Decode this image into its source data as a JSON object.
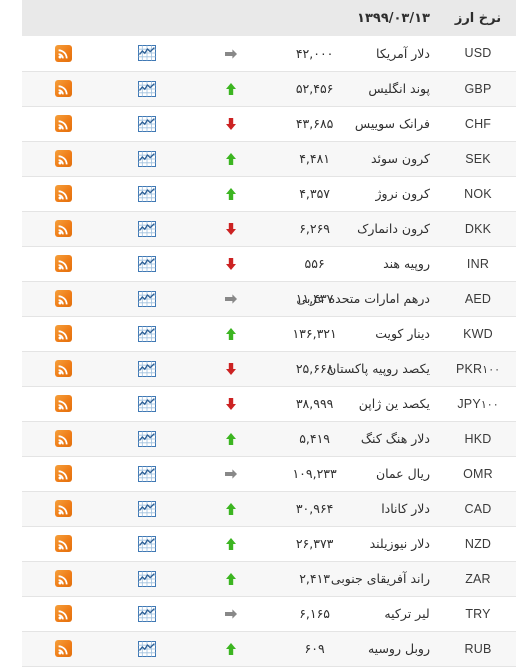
{
  "header": {
    "title": "نرخ ارز",
    "date": "۱۳۹۹/۰۳/۱۳"
  },
  "icons": {
    "rss": "rss-icon",
    "chart": "chart-icon",
    "trend_up": "arrow-up-icon",
    "trend_down": "arrow-down-icon",
    "trend_flat": "arrow-right-icon"
  },
  "colors": {
    "up": "#3cb521",
    "down": "#cc2222",
    "flat": "#888888",
    "rss_orange": "#ef7d18",
    "chart_blue": "#3f78b4",
    "header_bg": "#e9e9e9",
    "row_alt_bg": "#f7f7f7",
    "row_border": "#e4e4e4"
  },
  "rows": [
    {
      "code": "USD",
      "mult": "",
      "name": "دلار آمریکا",
      "value": "۴۲,۰۰۰",
      "trend": "flat"
    },
    {
      "code": "GBP",
      "mult": "",
      "name": "پوند انگلیس",
      "value": "۵۲,۴۵۶",
      "trend": "up"
    },
    {
      "code": "CHF",
      "mult": "",
      "name": "فرانک سوییس",
      "value": "۴۳,۶۸۵",
      "trend": "down"
    },
    {
      "code": "SEK",
      "mult": "",
      "name": "کرون سوئد",
      "value": "۴,۴۸۱",
      "trend": "up"
    },
    {
      "code": "NOK",
      "mult": "",
      "name": "کرون نروژ",
      "value": "۴,۳۵۷",
      "trend": "up"
    },
    {
      "code": "DKK",
      "mult": "",
      "name": "کرون دانمارک",
      "value": "۶,۲۶۹",
      "trend": "down"
    },
    {
      "code": "INR",
      "mult": "",
      "name": "روپیه هند",
      "value": "۵۵۶",
      "trend": "down"
    },
    {
      "code": "AED",
      "mult": "",
      "name": "درهم امارات متحده عربی",
      "value": "۱۱,۴۳۷",
      "trend": "flat"
    },
    {
      "code": "KWD",
      "mult": "",
      "name": "دینار کویت",
      "value": "۱۳۶,۳۲۱",
      "trend": "up"
    },
    {
      "code": "PKR",
      "mult": "۱۰۰",
      "name": "یکصد روپیه پاکستان",
      "value": "۲۵,۶۶۸",
      "trend": "down"
    },
    {
      "code": "JPY",
      "mult": "۱۰۰",
      "name": "یکصد ین ژاپن",
      "value": "۳۸,۹۹۹",
      "trend": "down"
    },
    {
      "code": "HKD",
      "mult": "",
      "name": "دلار هنگ کنگ",
      "value": "۵,۴۱۹",
      "trend": "up"
    },
    {
      "code": "OMR",
      "mult": "",
      "name": "ریال عمان",
      "value": "۱۰۹,۲۳۳",
      "trend": "flat"
    },
    {
      "code": "CAD",
      "mult": "",
      "name": "دلار کانادا",
      "value": "۳۰,۹۶۴",
      "trend": "up"
    },
    {
      "code": "NZD",
      "mult": "",
      "name": "دلار نیوزیلند",
      "value": "۲۶,۳۷۳",
      "trend": "up"
    },
    {
      "code": "ZAR",
      "mult": "",
      "name": "راند آفریقای جنوبی",
      "value": "۲,۴۱۳",
      "trend": "up"
    },
    {
      "code": "TRY",
      "mult": "",
      "name": "لیر ترکیه",
      "value": "۶,۱۶۵",
      "trend": "flat"
    },
    {
      "code": "RUB",
      "mult": "",
      "name": "روبل روسیه",
      "value": "۶۰۹",
      "trend": "up"
    }
  ]
}
